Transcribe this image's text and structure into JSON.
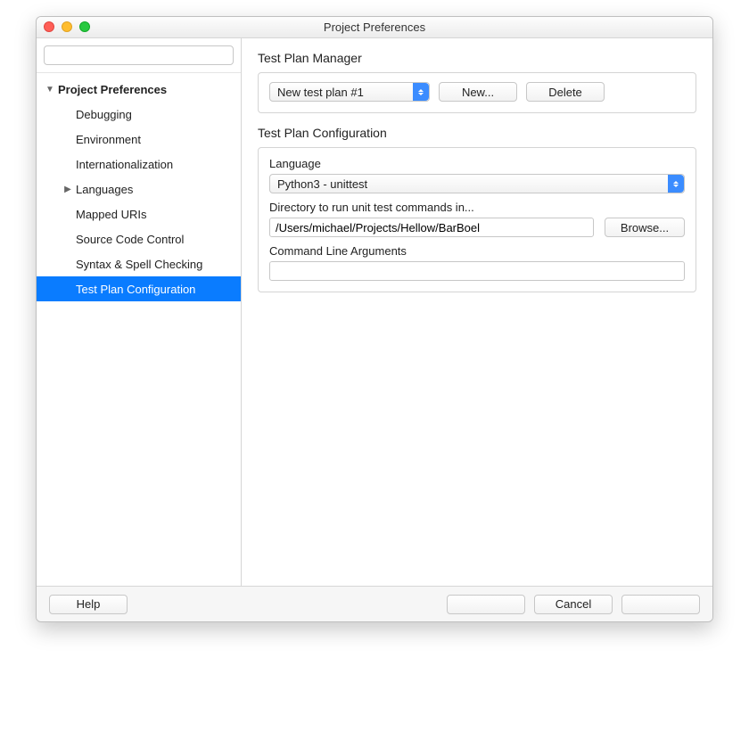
{
  "window": {
    "title": "Project Preferences"
  },
  "sidebar": {
    "search_placeholder": "",
    "root_label": "Project Preferences",
    "items": [
      {
        "label": "Debugging"
      },
      {
        "label": "Environment"
      },
      {
        "label": "Internationalization"
      },
      {
        "label": "Languages",
        "expandable": true
      },
      {
        "label": "Mapped URIs"
      },
      {
        "label": "Source Code Control"
      },
      {
        "label": "Syntax & Spell Checking"
      },
      {
        "label": "Test Plan Configuration",
        "selected": true
      }
    ]
  },
  "main": {
    "manager": {
      "title": "Test Plan Manager",
      "plan_select_value": "New test plan #1",
      "new_button": "New...",
      "delete_button": "Delete"
    },
    "config": {
      "title": "Test Plan Configuration",
      "language_label": "Language",
      "language_value": "Python3 - unittest",
      "directory_label": "Directory to run unit test commands in...",
      "directory_value": "/Users/michael/Projects/Hellow/BarBoel",
      "browse_button": "Browse...",
      "args_label": "Command Line Arguments",
      "args_value": ""
    }
  },
  "footer": {
    "help": "Help",
    "blank1": "",
    "cancel": "Cancel",
    "blank2": ""
  }
}
